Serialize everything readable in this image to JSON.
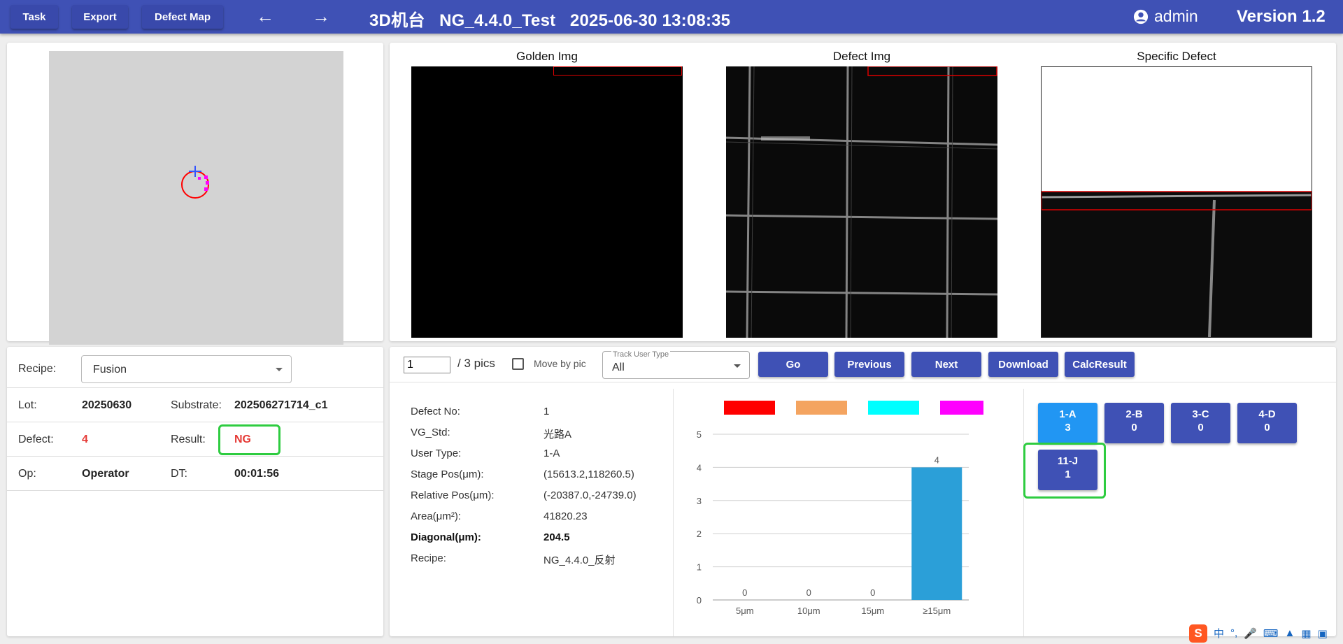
{
  "header": {
    "buttons": [
      "Task",
      "Export",
      "Defect Map"
    ],
    "back_icon": "arrow-left-icon",
    "forward_icon": "arrow-right-icon",
    "title": "3D机台   NG_4.4.0_Test   2025-06-30 13:08:35",
    "user": "admin",
    "user_icon": "account-circle-icon",
    "version": "Version 1.2"
  },
  "images": {
    "golden_caption": "Golden Img",
    "defect_caption": "Defect Img",
    "specific_caption": "Specific Defect"
  },
  "info": {
    "recipe_label": "Recipe:",
    "recipe_value": "Fusion",
    "lot_label": "Lot:",
    "lot_value": "20250630",
    "substrate_label": "Substrate:",
    "substrate_value": "202506271714_c1",
    "defect_label": "Defect:",
    "defect_value": "4",
    "result_label": "Result:",
    "result_value": "NG",
    "op_label": "Op:",
    "op_value": "Operator",
    "dt_label": "DT:",
    "dt_value": "00:01:56"
  },
  "toolbar": {
    "page_value": "1",
    "page_total": "/ 3 pics",
    "move_by_pic": "Move by pic",
    "track_label": "Track User Type",
    "track_value": "All",
    "go": "Go",
    "previous": "Previous",
    "next": "Next",
    "download": "Download",
    "calc": "CalcResult"
  },
  "details": [
    {
      "label": "Defect No:",
      "value": "1",
      "bold": false
    },
    {
      "label": "VG_Std:",
      "value": "光路A",
      "bold": false
    },
    {
      "label": "User Type:",
      "value": "1-A",
      "bold": false
    },
    {
      "label": "Stage Pos(μm):",
      "value": "(15613.2,118260.5)",
      "bold": false
    },
    {
      "label": "Relative Pos(μm):",
      "value": "(-20387.0,-24739.0)",
      "bold": false
    },
    {
      "label": "Area(μm²):",
      "value": "41820.23",
      "bold": false
    },
    {
      "label": "Diagonal(μm):",
      "value": "204.5",
      "bold": true
    },
    {
      "label": "Recipe:",
      "value": "NG_4.4.0_反射",
      "bold": false
    }
  ],
  "chart_data": {
    "type": "bar",
    "categories": [
      "5μm",
      "10μm",
      "15μm",
      "≥15μm"
    ],
    "values": [
      0,
      0,
      0,
      4
    ],
    "ylim": [
      0,
      5
    ],
    "yticks": [
      "0",
      "1",
      "2",
      "3",
      "4",
      "5"
    ],
    "legend_colors": [
      "#ff0000",
      "#f4a460",
      "#00ffff",
      "#ff00ff"
    ],
    "bar_color": "#2b9fd8",
    "grid": true,
    "legend_position": "top"
  },
  "user_types": [
    {
      "name": "1-A",
      "count": "3",
      "color": "#2196f3"
    },
    {
      "name": "2-B",
      "count": "0",
      "color": "#3f51b5"
    },
    {
      "name": "3-C",
      "count": "0",
      "color": "#3f51b5"
    },
    {
      "name": "4-D",
      "count": "0",
      "color": "#3f51b5"
    },
    {
      "name": "11-J",
      "count": "1",
      "color": "#3f51b5"
    }
  ],
  "tray": {
    "ime_char": "中",
    "icons": [
      "sogou-s-icon",
      "punctuation-icon",
      "mic-icon",
      "keyboard-icon",
      "shirt-icon",
      "grid-icon",
      "toolbox-icon"
    ]
  }
}
